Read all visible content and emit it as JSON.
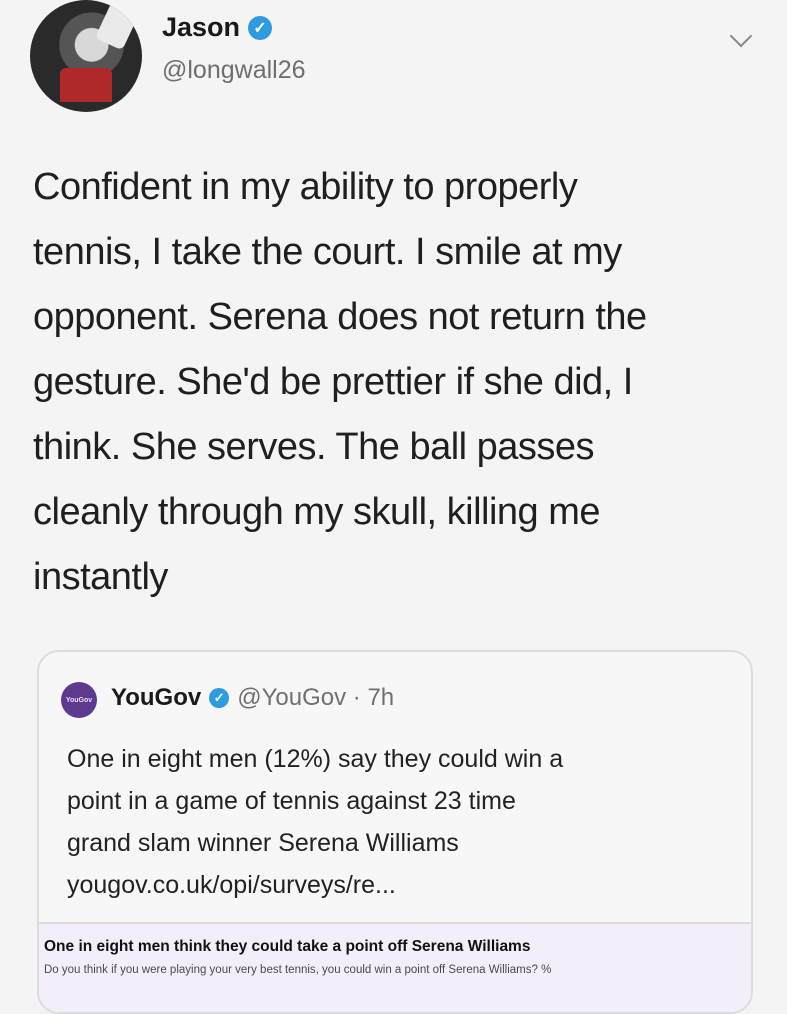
{
  "author": {
    "display_name": "Jason",
    "handle": "@longwall26",
    "verified": true
  },
  "tweet_text_lines": [
    "Confident in my ability to properly",
    "tennis, I take the court. I smile at my",
    "opponent. Serena does not return the",
    "gesture. She'd be prettier if she did, I",
    "think. She serves. The ball passes",
    "cleanly through my skull, killing me",
    "instantly"
  ],
  "quoted_tweet": {
    "avatar_text": "YouGov",
    "name": "YouGov",
    "verified": true,
    "meta": "@YouGov · 7h",
    "text_lines": [
      "One in eight men (12%) say they could win a",
      "point in a game of tennis against 23 time",
      "grand slam winner Serena Williams",
      "yougov.co.uk/opi/surveys/re..."
    ],
    "link_card": {
      "title": "One in eight men think they could take a point off Serena Williams",
      "description": "Do you think if you were playing your very best tennis, you could win a point off Serena Williams? %"
    }
  },
  "icons": {
    "verified": "verified-check-icon",
    "menu": "chevron-down-icon"
  },
  "colors": {
    "verified_blue": "#2f9bdf",
    "yougov_purple": "#5d3a8e",
    "link_card_bg": "#f4eefb"
  }
}
